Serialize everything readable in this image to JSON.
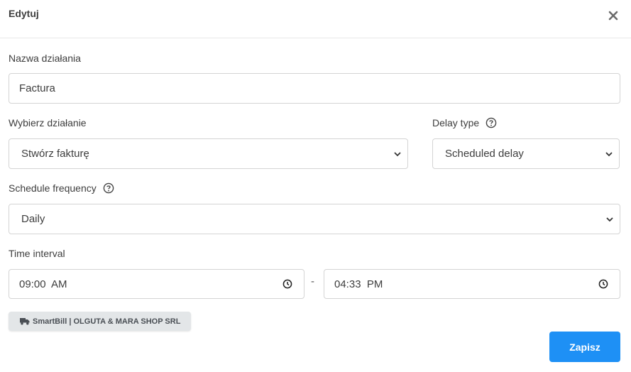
{
  "dialog": {
    "title": "Edytuj"
  },
  "action_name": {
    "label": "Nazwa działania",
    "value": "Factura"
  },
  "action_select": {
    "label": "Wybierz działanie",
    "value": "Stwórz fakturę"
  },
  "delay_type": {
    "label": "Delay type",
    "value": "Scheduled delay"
  },
  "schedule_frequency": {
    "label": "Schedule frequency",
    "value": "Daily"
  },
  "time_interval": {
    "label": "Time interval",
    "start": "09:00  AM",
    "separator": "-",
    "end": "04:33  PM"
  },
  "integration_badge": {
    "text": "SmartBill | OLGUTA & MARA SHOP SRL",
    "icon": "truck-icon"
  },
  "footer": {
    "save_label": "Zapisz"
  },
  "colors": {
    "primary": "#1e90f5",
    "badge_bg": "#e3e6e8",
    "border": "#d4d4d4"
  }
}
